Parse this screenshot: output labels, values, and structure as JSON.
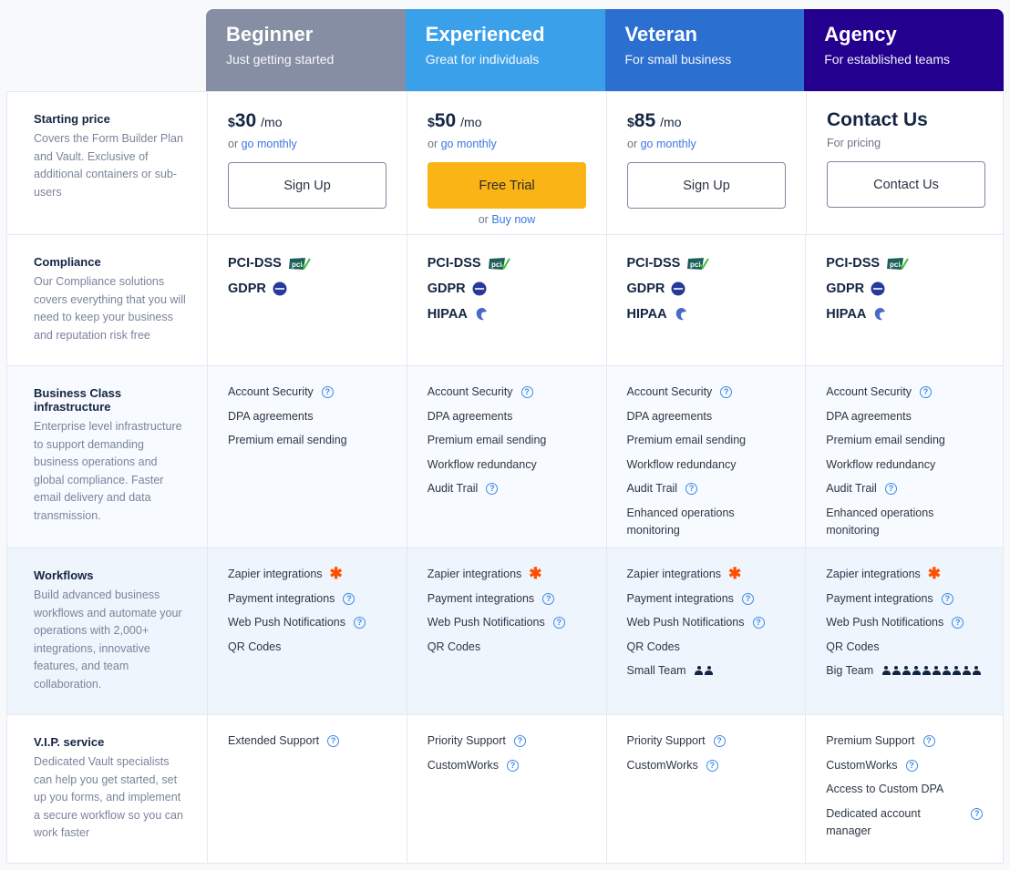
{
  "plans": [
    {
      "name": "Beginner",
      "tagline": "Just getting started",
      "color": "#858ea3"
    },
    {
      "name": "Experienced",
      "tagline": "Great for individuals",
      "color": "#3ba0ea"
    },
    {
      "name": "Veteran",
      "tagline": "For small business",
      "color": "#2b6fd1"
    },
    {
      "name": "Agency",
      "tagline": "For established teams",
      "color": "#24008f"
    }
  ],
  "rows": {
    "pricing": {
      "title": "Starting price",
      "description": "Covers the Form Builder Plan and Vault. Exclusive of additional containers or sub-users"
    },
    "compliance": {
      "title": "Compliance",
      "description": "Our Compliance solutions covers everything that you will need to keep your business and reputation risk free"
    },
    "infrastructure": {
      "title": "Business Class infrastructure",
      "description": "Enterprise level infrastructure to support demanding business operations and global compliance. Faster email delivery and data transmission."
    },
    "workflows": {
      "title": "Workflows",
      "description": "Build advanced business workflows and automate your operations with 2,000+ integrations, innovative features, and team collaboration."
    },
    "vip": {
      "title": "V.I.P. service",
      "description": "Dedicated Vault specialists can help you get started, set up you forms, and implement a secure workflow so you can work faster"
    }
  },
  "pricing": [
    {
      "currency": "$",
      "amount": "30",
      "period": "/mo",
      "or": "or",
      "link": "go monthly",
      "button": "Sign Up"
    },
    {
      "currency": "$",
      "amount": "50",
      "period": "/mo",
      "or": "or",
      "link": "go monthly",
      "button": "Free Trial",
      "button_sub_or": "or",
      "button_sub_link": "Buy now"
    },
    {
      "currency": "$",
      "amount": "85",
      "period": "/mo",
      "or": "or",
      "link": "go monthly",
      "button": "Sign Up"
    },
    {
      "title": "Contact Us",
      "subtitle": "For pricing",
      "button": "Contact Us"
    }
  ],
  "compliance": [
    [
      "PCI-DSS",
      "GDPR"
    ],
    [
      "PCI-DSS",
      "GDPR",
      "HIPAA"
    ],
    [
      "PCI-DSS",
      "GDPR",
      "HIPAA"
    ],
    [
      "PCI-DSS",
      "GDPR",
      "HIPAA"
    ]
  ],
  "infrastructure": [
    [
      "Account Security",
      "DPA agreements",
      "Premium email sending"
    ],
    [
      "Account Security",
      "DPA agreements",
      "Premium email sending",
      "Workflow redundancy",
      "Audit Trail"
    ],
    [
      "Account Security",
      "DPA agreements",
      "Premium email sending",
      "Workflow redundancy",
      "Audit Trail",
      "Enhanced operations monitoring"
    ],
    [
      "Account Security",
      "DPA agreements",
      "Premium email sending",
      "Workflow redundancy",
      "Audit Trail",
      "Enhanced operations monitoring"
    ]
  ],
  "workflows": [
    [
      "Zapier integrations",
      "Payment integrations",
      "Web Push Notifications",
      "QR Codes"
    ],
    [
      "Zapier integrations",
      "Payment integrations",
      "Web Push Notifications",
      "QR Codes"
    ],
    [
      "Zapier integrations",
      "Payment integrations",
      "Web Push Notifications",
      "QR Codes",
      "Small Team"
    ],
    [
      "Zapier integrations",
      "Payment integrations",
      "Web Push Notifications",
      "QR Codes",
      "Big Team"
    ]
  ],
  "team_sizes": {
    "Small Team": 2,
    "Big Team": 10
  },
  "vip": [
    [
      "Extended Support"
    ],
    [
      "Priority Support",
      "CustomWorks"
    ],
    [
      "Priority Support",
      "CustomWorks"
    ],
    [
      "Premium Support",
      "CustomWorks",
      "Access to Custom DPA",
      "Dedicated account manager"
    ]
  ],
  "help_icon_features": [
    "Account Security",
    "Audit Trail",
    "Payment integrations",
    "Web Push Notifications",
    "Extended Support",
    "Priority Support",
    "Premium Support",
    "CustomWorks",
    "Dedicated account manager"
  ],
  "zapier_icon_features": [
    "Zapier integrations"
  ],
  "help_glyph": "?",
  "zapier_glyph": "✱"
}
